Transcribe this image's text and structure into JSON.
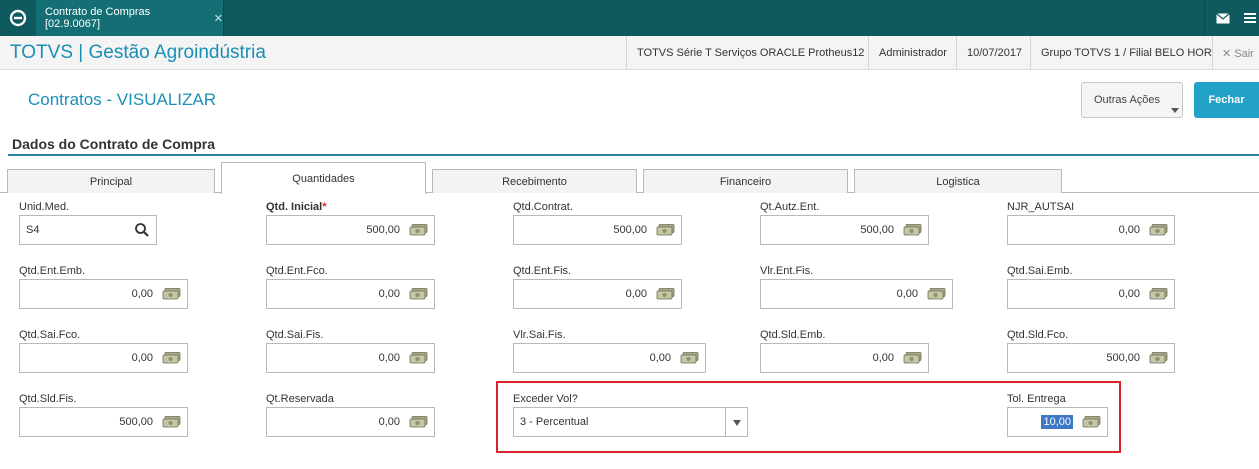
{
  "topbar": {
    "tab_title": "Contrato de Compras [02.9.0067]",
    "tab_close": "✕"
  },
  "header": {
    "brand": "TOTVS | Gestão Agroindústria",
    "environment": "TOTVS Série T Serviços ORACLE Protheus12",
    "user": "Administrador",
    "date": "10/07/2017",
    "branch": "Grupo TOTVS 1 / Filial BELO HOR",
    "logout": "✕ Sair"
  },
  "page": {
    "title": "Contratos - VISUALIZAR",
    "other_actions_label": "Outras Ações",
    "close_label": "Fechar",
    "section_title": "Dados do Contrato de Compra"
  },
  "tabs": [
    {
      "label": "Principal"
    },
    {
      "label": "Quantidades"
    },
    {
      "label": "Recebimento"
    },
    {
      "label": "Financeiro"
    },
    {
      "label": "Logistica"
    }
  ],
  "active_tab": "Quantidades",
  "fields": {
    "unid_med": {
      "label": "Unid.Med.",
      "value": "S4"
    },
    "qtd_inicial": {
      "label": "Qtd. Inicial",
      "required_mark": "*",
      "value": "500,00"
    },
    "qtd_contrat": {
      "label": "Qtd.Contrat.",
      "value": "500,00"
    },
    "qt_autz_ent": {
      "label": "Qt.Autz.Ent.",
      "value": "500,00"
    },
    "njr_autsai": {
      "label": "NJR_AUTSAI",
      "value": "0,00"
    },
    "qtd_ent_emb": {
      "label": "Qtd.Ent.Emb.",
      "value": "0,00"
    },
    "qtd_ent_fco": {
      "label": "Qtd.Ent.Fco.",
      "value": "0,00"
    },
    "qtd_ent_fis": {
      "label": "Qtd.Ent.Fis.",
      "value": "0,00"
    },
    "vlr_ent_fis": {
      "label": "Vlr.Ent.Fis.",
      "value": "0,00"
    },
    "qtd_sai_emb": {
      "label": "Qtd.Sai.Emb.",
      "value": "0,00"
    },
    "qtd_sai_fco": {
      "label": "Qtd.Sai.Fco.",
      "value": "0,00"
    },
    "qtd_sai_fis": {
      "label": "Qtd.Sai.Fis.",
      "value": "0,00"
    },
    "vlr_sai_fis": {
      "label": "Vlr.Sai.Fis.",
      "value": "0,00"
    },
    "qtd_sld_emb": {
      "label": "Qtd.Sld.Emb.",
      "value": "0,00"
    },
    "qtd_sld_fco": {
      "label": "Qtd.Sld.Fco.",
      "value": "500,00"
    },
    "qtd_sld_fis": {
      "label": "Qtd.Sld.Fis.",
      "value": "500,00"
    },
    "qt_reservada": {
      "label": "Qt.Reservada",
      "value": "0,00"
    },
    "exceder_vol": {
      "label": "Exceder Vol?",
      "value": "3 - Percentual"
    },
    "tol_entrega": {
      "label": "Tol. Entrega",
      "value": "10,00"
    }
  },
  "colors": {
    "topbar": "#0e5a5e",
    "brand": "#1a8fb6",
    "primary_button": "#23a2c7",
    "highlight_box": "#d8242c",
    "selection": "#3c77c8"
  }
}
